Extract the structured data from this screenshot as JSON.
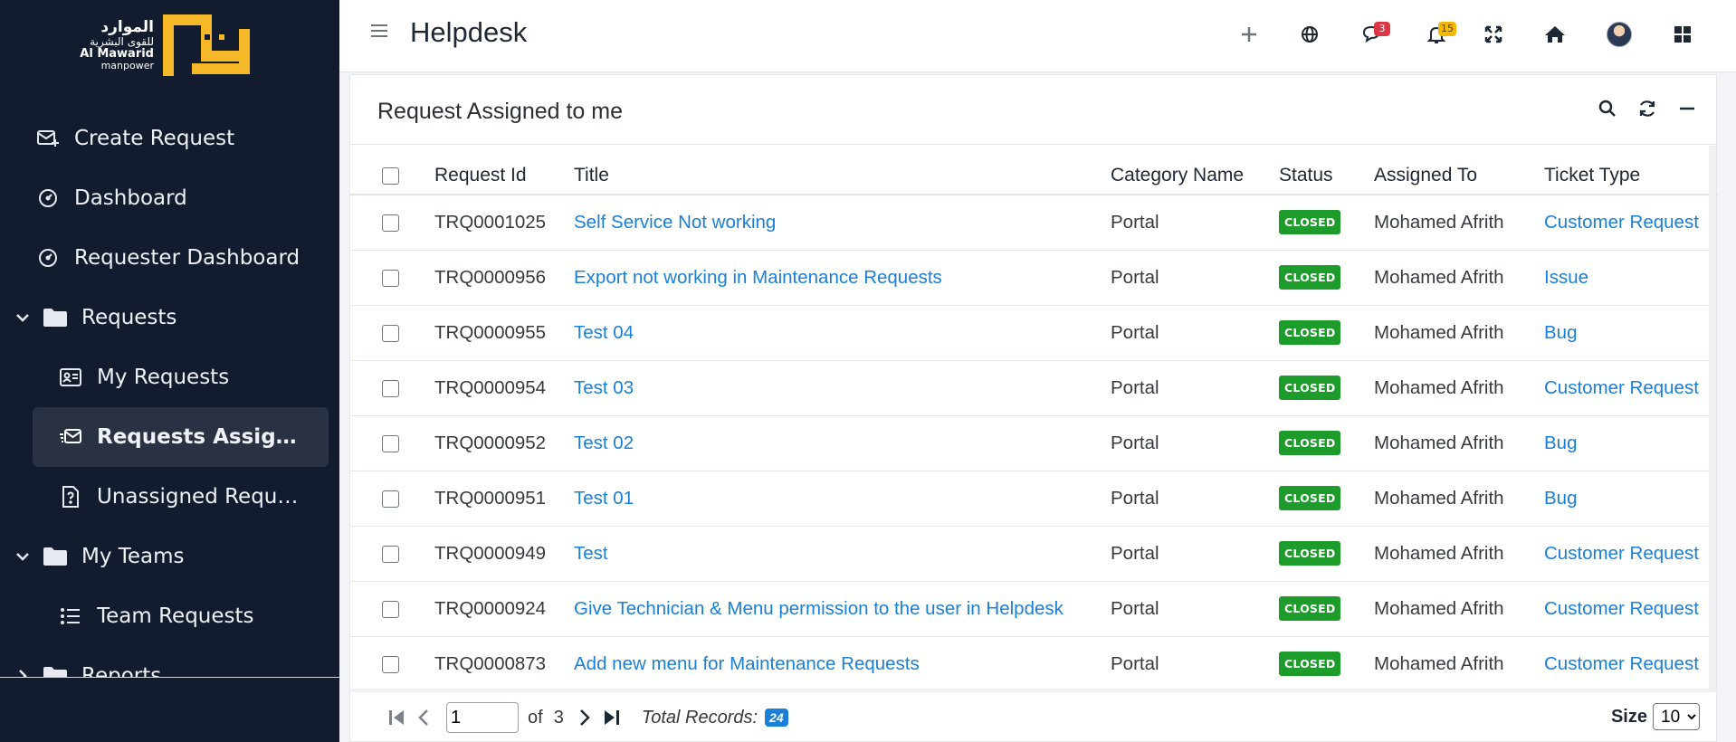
{
  "logo": {
    "arabic_line1": "الموارد",
    "arabic_line2": "للقوى البشرية",
    "english_line1": "Al Mawarid",
    "english_line2": "manpower",
    "brand_color": "#f5b829"
  },
  "sidebar": {
    "items": [
      {
        "label": "Create Request",
        "icon": "envelope-plus-icon"
      },
      {
        "label": "Dashboard",
        "icon": "gauge-icon"
      },
      {
        "label": "Requester Dashboard",
        "icon": "gauge-icon"
      },
      {
        "label": "Requests",
        "icon": "folder-icon",
        "group": true,
        "expanded": true
      },
      {
        "label": "My Requests",
        "icon": "id-card-icon"
      },
      {
        "label": "Requests Assigned...",
        "icon": "envelope-open-icon",
        "active": true
      },
      {
        "label": "Unassigned Reque...",
        "icon": "file-question-icon"
      },
      {
        "label": "My Teams",
        "icon": "folder-icon",
        "group": true,
        "expanded": true
      },
      {
        "label": "Team Requests",
        "icon": "list-icon"
      },
      {
        "label": "Reports",
        "icon": "folder-icon",
        "group": true,
        "expanded": false
      }
    ]
  },
  "header": {
    "title": "Helpdesk",
    "messages_count": "3",
    "notifications_count": "15"
  },
  "card": {
    "title": "Request Assigned to me"
  },
  "table": {
    "columns": [
      "Request Id",
      "Title",
      "Category Name",
      "Status",
      "Assigned To",
      "Ticket Type"
    ],
    "rows": [
      {
        "id": "TRQ0001025",
        "title": "Self Service Not working",
        "category": "Portal",
        "status": "CLOSED",
        "assigned": "Mohamed Afrith",
        "type": "Customer Request"
      },
      {
        "id": "TRQ0000956",
        "title": "Export not working in Maintenance Requests",
        "category": "Portal",
        "status": "CLOSED",
        "assigned": "Mohamed Afrith",
        "type": "Issue"
      },
      {
        "id": "TRQ0000955",
        "title": "Test 04",
        "category": "Portal",
        "status": "CLOSED",
        "assigned": "Mohamed Afrith",
        "type": "Bug"
      },
      {
        "id": "TRQ0000954",
        "title": "Test 03",
        "category": "Portal",
        "status": "CLOSED",
        "assigned": "Mohamed Afrith",
        "type": "Customer Request"
      },
      {
        "id": "TRQ0000952",
        "title": "Test 02",
        "category": "Portal",
        "status": "CLOSED",
        "assigned": "Mohamed Afrith",
        "type": "Bug"
      },
      {
        "id": "TRQ0000951",
        "title": "Test 01",
        "category": "Portal",
        "status": "CLOSED",
        "assigned": "Mohamed Afrith",
        "type": "Bug"
      },
      {
        "id": "TRQ0000949",
        "title": "Test",
        "category": "Portal",
        "status": "CLOSED",
        "assigned": "Mohamed Afrith",
        "type": "Customer Request"
      },
      {
        "id": "TRQ0000924",
        "title": "Give Technician & Menu permission to the user in Helpdesk",
        "category": "Portal",
        "status": "CLOSED",
        "assigned": "Mohamed Afrith",
        "type": "Customer Request"
      },
      {
        "id": "TRQ0000873",
        "title": "Add new menu for Maintenance Requests",
        "category": "Portal",
        "status": "CLOSED",
        "assigned": "Mohamed Afrith",
        "type": "Customer Request"
      }
    ]
  },
  "pager": {
    "current_page": "1",
    "of_label": "of",
    "total_pages": "3",
    "total_label": "Total Records:",
    "total_records": "24",
    "size_label": "Size",
    "size_value": "10"
  },
  "colors": {
    "sidebar_bg": "#131c2e",
    "link": "#1a7fd6",
    "status_closed": "#1d9b2b"
  }
}
